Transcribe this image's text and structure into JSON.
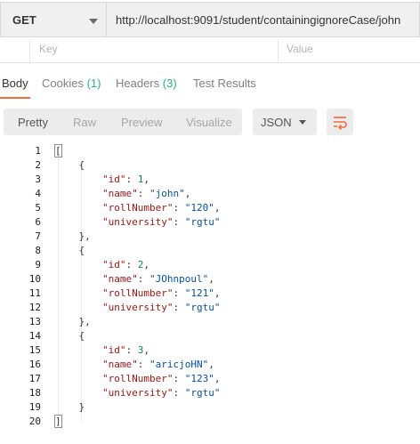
{
  "request": {
    "method": "GET",
    "url": "http://localhost:9091/student/containingignoreCase/john"
  },
  "params": {
    "key_header": "Key",
    "value_header": "Value"
  },
  "tabs": {
    "body": "Body",
    "cookies": "Cookies",
    "cookies_count": "(1)",
    "headers": "Headers",
    "headers_count": "(3)",
    "test_results": "Test Results",
    "active": "Body"
  },
  "view": {
    "pretty": "Pretty",
    "raw": "Raw",
    "preview": "Preview",
    "visualize": "Visualize",
    "format": "JSON",
    "active": "Pretty"
  },
  "icons": {
    "method_dropdown": "chevron-down-icon",
    "format_dropdown": "chevron-down-icon",
    "wrap": "wrap-lines-icon"
  },
  "colors": {
    "accent": "#f26b3a",
    "count": "#26b47f",
    "json_key": "#a31515",
    "json_string": "#0451a5",
    "json_number": "#098658"
  },
  "code": {
    "line_numbers": [
      "1",
      "2",
      "3",
      "4",
      "5",
      "6",
      "7",
      "8",
      "9",
      "10",
      "11",
      "12",
      "13",
      "14",
      "15",
      "16",
      "17",
      "18",
      "19",
      "20"
    ],
    "lines": [
      [
        {
          "t": "[",
          "c": "p"
        }
      ],
      [
        {
          "t": "    {",
          "c": "p"
        }
      ],
      [
        {
          "t": "        ",
          "c": "p"
        },
        {
          "t": "\"id\"",
          "c": "k"
        },
        {
          "t": ": ",
          "c": "p"
        },
        {
          "t": "1",
          "c": "n"
        },
        {
          "t": ",",
          "c": "p"
        }
      ],
      [
        {
          "t": "        ",
          "c": "p"
        },
        {
          "t": "\"name\"",
          "c": "k"
        },
        {
          "t": ": ",
          "c": "p"
        },
        {
          "t": "\"john\"",
          "c": "s"
        },
        {
          "t": ",",
          "c": "p"
        }
      ],
      [
        {
          "t": "        ",
          "c": "p"
        },
        {
          "t": "\"rollNumber\"",
          "c": "k"
        },
        {
          "t": ": ",
          "c": "p"
        },
        {
          "t": "\"120\"",
          "c": "s"
        },
        {
          "t": ",",
          "c": "p"
        }
      ],
      [
        {
          "t": "        ",
          "c": "p"
        },
        {
          "t": "\"university\"",
          "c": "k"
        },
        {
          "t": ": ",
          "c": "p"
        },
        {
          "t": "\"rgtu\"",
          "c": "s"
        }
      ],
      [
        {
          "t": "    },",
          "c": "p"
        }
      ],
      [
        {
          "t": "    {",
          "c": "p"
        }
      ],
      [
        {
          "t": "        ",
          "c": "p"
        },
        {
          "t": "\"id\"",
          "c": "k"
        },
        {
          "t": ": ",
          "c": "p"
        },
        {
          "t": "2",
          "c": "n"
        },
        {
          "t": ",",
          "c": "p"
        }
      ],
      [
        {
          "t": "        ",
          "c": "p"
        },
        {
          "t": "\"name\"",
          "c": "k"
        },
        {
          "t": ": ",
          "c": "p"
        },
        {
          "t": "\"JOhnpoul\"",
          "c": "s"
        },
        {
          "t": ",",
          "c": "p"
        }
      ],
      [
        {
          "t": "        ",
          "c": "p"
        },
        {
          "t": "\"rollNumber\"",
          "c": "k"
        },
        {
          "t": ": ",
          "c": "p"
        },
        {
          "t": "\"121\"",
          "c": "s"
        },
        {
          "t": ",",
          "c": "p"
        }
      ],
      [
        {
          "t": "        ",
          "c": "p"
        },
        {
          "t": "\"university\"",
          "c": "k"
        },
        {
          "t": ": ",
          "c": "p"
        },
        {
          "t": "\"rgtu\"",
          "c": "s"
        }
      ],
      [
        {
          "t": "    },",
          "c": "p"
        }
      ],
      [
        {
          "t": "    {",
          "c": "p"
        }
      ],
      [
        {
          "t": "        ",
          "c": "p"
        },
        {
          "t": "\"id\"",
          "c": "k"
        },
        {
          "t": ": ",
          "c": "p"
        },
        {
          "t": "3",
          "c": "n"
        },
        {
          "t": ",",
          "c": "p"
        }
      ],
      [
        {
          "t": "        ",
          "c": "p"
        },
        {
          "t": "\"name\"",
          "c": "k"
        },
        {
          "t": ": ",
          "c": "p"
        },
        {
          "t": "\"aricjoHN\"",
          "c": "s"
        },
        {
          "t": ",",
          "c": "p"
        }
      ],
      [
        {
          "t": "        ",
          "c": "p"
        },
        {
          "t": "\"rollNumber\"",
          "c": "k"
        },
        {
          "t": ": ",
          "c": "p"
        },
        {
          "t": "\"123\"",
          "c": "s"
        },
        {
          "t": ",",
          "c": "p"
        }
      ],
      [
        {
          "t": "        ",
          "c": "p"
        },
        {
          "t": "\"university\"",
          "c": "k"
        },
        {
          "t": ": ",
          "c": "p"
        },
        {
          "t": "\"rgtu\"",
          "c": "s"
        }
      ],
      [
        {
          "t": "    }",
          "c": "p"
        }
      ],
      [
        {
          "t": "]",
          "c": "p"
        }
      ]
    ]
  }
}
